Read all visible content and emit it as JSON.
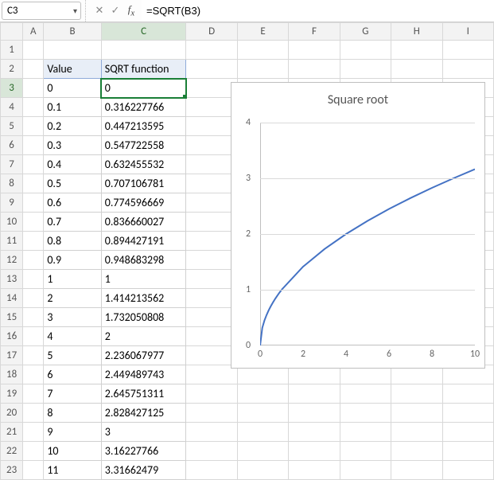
{
  "formula_bar": {
    "cell_ref": "C3",
    "formula": "=SQRT(B3)"
  },
  "columns": [
    "A",
    "B",
    "C",
    "D",
    "E",
    "F",
    "G",
    "H",
    "I"
  ],
  "row_count": 23,
  "selected": {
    "row": 3,
    "col": "C"
  },
  "table": {
    "headers": {
      "value": "Value",
      "result": "SQRT function"
    },
    "rows": [
      {
        "value": "0",
        "result": "0"
      },
      {
        "value": "0.1",
        "result": "0.316227766"
      },
      {
        "value": "0.2",
        "result": "0.447213595"
      },
      {
        "value": "0.3",
        "result": "0.547722558"
      },
      {
        "value": "0.4",
        "result": "0.632455532"
      },
      {
        "value": "0.5",
        "result": "0.707106781"
      },
      {
        "value": "0.6",
        "result": "0.774596669"
      },
      {
        "value": "0.7",
        "result": "0.836660027"
      },
      {
        "value": "0.8",
        "result": "0.894427191"
      },
      {
        "value": "0.9",
        "result": "0.948683298"
      },
      {
        "value": "1",
        "result": "1"
      },
      {
        "value": "2",
        "result": "1.414213562"
      },
      {
        "value": "3",
        "result": "1.732050808"
      },
      {
        "value": "4",
        "result": "2"
      },
      {
        "value": "5",
        "result": "2.236067977"
      },
      {
        "value": "6",
        "result": "2.449489743"
      },
      {
        "value": "7",
        "result": "2.645751311"
      },
      {
        "value": "8",
        "result": "2.828427125"
      },
      {
        "value": "9",
        "result": "3"
      },
      {
        "value": "10",
        "result": "3.16227766"
      },
      {
        "value": "11",
        "result": "3.31662479"
      }
    ]
  },
  "chart_data": {
    "type": "line",
    "title": "Square root",
    "xlabel": "",
    "ylabel": "",
    "xlim": [
      0,
      10
    ],
    "ylim": [
      0,
      4
    ],
    "xticks": [
      0,
      2,
      4,
      6,
      8,
      10
    ],
    "yticks": [
      0,
      1,
      2,
      3,
      4
    ],
    "series": [
      {
        "name": "SQRT function",
        "x": [
          0,
          0.1,
          0.2,
          0.3,
          0.4,
          0.5,
          0.6,
          0.7,
          0.8,
          0.9,
          1,
          2,
          3,
          4,
          5,
          6,
          7,
          8,
          9,
          10
        ],
        "y": [
          0,
          0.316227766,
          0.447213595,
          0.547722558,
          0.632455532,
          0.707106781,
          0.774596669,
          0.836660027,
          0.894427191,
          0.948683298,
          1,
          1.414213562,
          1.732050808,
          2,
          2.236067977,
          2.449489743,
          2.645751311,
          2.828427125,
          3,
          3.16227766
        ]
      }
    ]
  }
}
